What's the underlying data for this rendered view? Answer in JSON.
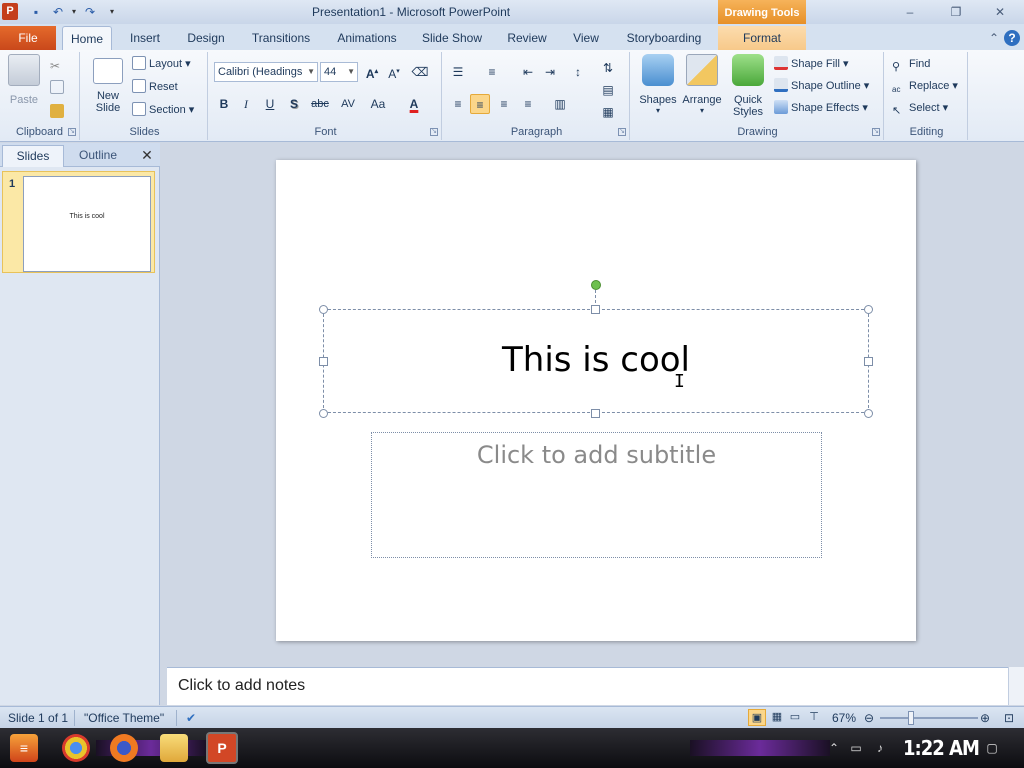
{
  "window": {
    "title": "Presentation1 - Microsoft PowerPoint",
    "context_tab_group": "Drawing Tools",
    "app_icon": "P"
  },
  "tabs": {
    "file": "File",
    "home": "Home",
    "insert": "Insert",
    "design": "Design",
    "transitions": "Transitions",
    "animations": "Animations",
    "slideshow": "Slide Show",
    "review": "Review",
    "view": "View",
    "storyboarding": "Storyboarding",
    "format": "Format"
  },
  "ribbon": {
    "clipboard": {
      "label": "Clipboard",
      "paste": "Paste"
    },
    "slides": {
      "label": "Slides",
      "new_slide_line1": "New",
      "new_slide_line2": "Slide",
      "layout": "Layout",
      "reset": "Reset",
      "section": "Section"
    },
    "font": {
      "label": "Font",
      "font_name": "Calibri (Headings",
      "font_size": "44",
      "bold": "B",
      "italic": "I",
      "underline": "U",
      "shadow": "S",
      "strike": "abc",
      "spacing": "AV",
      "case": "Aa",
      "color": "A"
    },
    "paragraph": {
      "label": "Paragraph"
    },
    "drawing": {
      "label": "Drawing",
      "shapes": "Shapes",
      "arrange": "Arrange",
      "quick_styles_line1": "Quick",
      "quick_styles_line2": "Styles",
      "shape_fill": "Shape Fill",
      "shape_outline": "Shape Outline",
      "shape_effects": "Shape Effects"
    },
    "editing": {
      "label": "Editing",
      "find": "Find",
      "replace": "Replace",
      "select": "Select"
    }
  },
  "slides_pane": {
    "tab_slides": "Slides",
    "tab_outline": "Outline",
    "thumbnails": [
      {
        "number": "1",
        "text": "This is cool"
      }
    ]
  },
  "slide": {
    "title": "This is cool",
    "subtitle_placeholder": "Click to add subtitle"
  },
  "notes": {
    "placeholder": "Click to add notes"
  },
  "status": {
    "slide_info": "Slide 1 of 1",
    "theme": "\"Office Theme\"",
    "zoom": "67%"
  },
  "taskbar": {
    "clock": "1:22 AM"
  },
  "colors": {
    "file_tab": "#d0551f",
    "context_tab": "#f0a040",
    "rotation_handle": "#6ec04e"
  }
}
